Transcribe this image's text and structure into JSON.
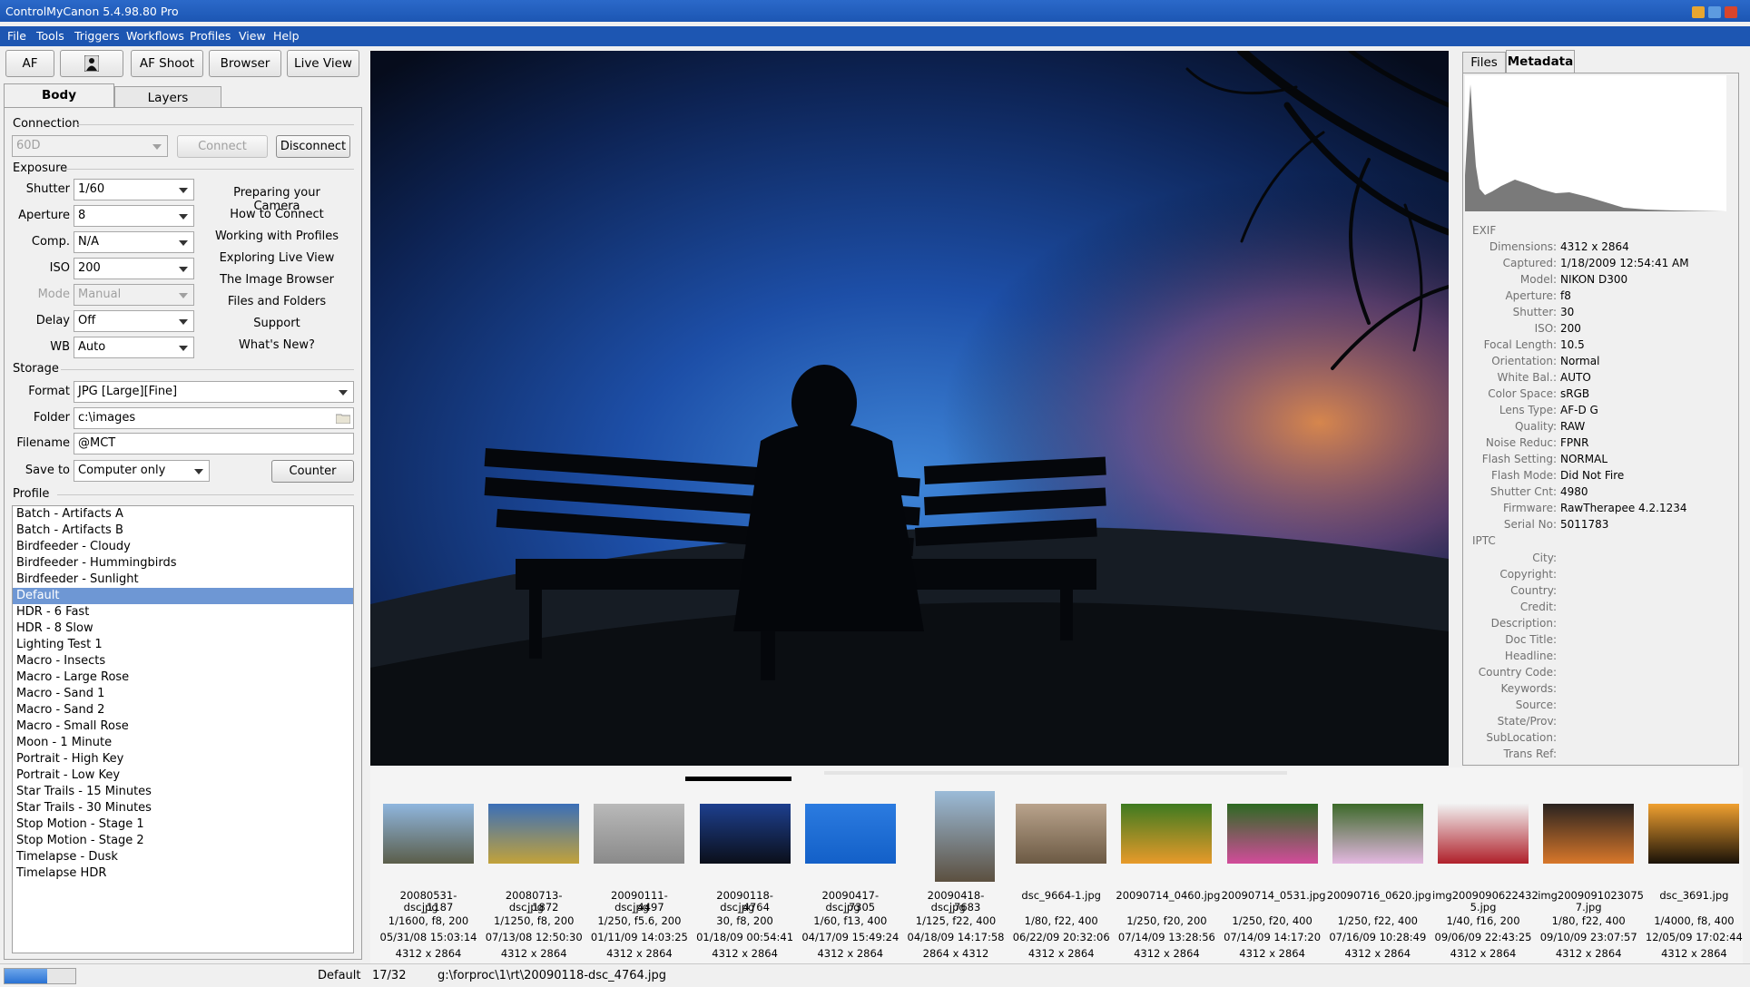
{
  "app": {
    "title": "ControlMyCanon 5.4.98.80 Pro",
    "menu": [
      "File",
      "Tools",
      "Triggers",
      "Workflows",
      "Profiles",
      "View",
      "Help"
    ]
  },
  "toolbar": {
    "af": "AF",
    "af_shoot": "AF Shoot",
    "browser": "Browser",
    "live_view": "Live View"
  },
  "left_tabs": [
    "Body",
    "Layers"
  ],
  "connection": {
    "section": "Connection",
    "camera_model": "60D",
    "connect": "Connect",
    "disconnect": "Disconnect"
  },
  "exposure": {
    "section": "Exposure",
    "fields": [
      {
        "label": "Shutter",
        "value": "1/60"
      },
      {
        "label": "Aperture",
        "value": "8"
      },
      {
        "label": "Comp.",
        "value": "N/A"
      },
      {
        "label": "ISO",
        "value": "200"
      },
      {
        "label": "Mode",
        "value": "Manual"
      },
      {
        "label": "Delay",
        "value": "Off"
      },
      {
        "label": "WB",
        "value": "Auto"
      }
    ]
  },
  "help_links": [
    "Preparing your Camera",
    "How to Connect",
    "Working with Profiles",
    "Exploring Live View",
    "The Image Browser",
    "Files and Folders",
    "Support",
    "What's New?"
  ],
  "storage": {
    "section": "Storage",
    "format_label": "Format",
    "format_value": "JPG [Large][Fine]",
    "folder_label": "Folder",
    "folder_value": "c:\\images",
    "filename_label": "Filename",
    "filename_value": "@MCT",
    "saveto_label": "Save to",
    "saveto_value": "Computer only",
    "counter": "Counter"
  },
  "profile": {
    "section": "Profile",
    "selected": "Default",
    "items": [
      "Batch - Artifacts A",
      "Batch - Artifacts B",
      "Birdfeeder - Cloudy",
      "Birdfeeder - Hummingbirds",
      "Birdfeeder - Sunlight",
      "Default",
      "HDR - 6 Fast",
      "HDR - 8 Slow",
      "Lighting Test 1",
      "Macro - Insects",
      "Macro - Large Rose",
      "Macro - Sand 1",
      "Macro - Sand 2",
      "Macro - Small Rose",
      "Moon - 1 Minute",
      "Portrait - High Key",
      "Portrait - Low Key",
      "Star Trails - 15 Minutes",
      "Star Trails - 30 Minutes",
      "Stop Motion - Stage 1",
      "Stop Motion - Stage 2",
      "Timelapse - Dusk",
      "Timelapse HDR"
    ]
  },
  "right_tabs": [
    "Files",
    "Metadata"
  ],
  "exif": {
    "title": "EXIF",
    "rows": [
      {
        "k": "Dimensions:",
        "v": "4312 x 2864"
      },
      {
        "k": "Captured:",
        "v": "1/18/2009 12:54:41 AM"
      },
      {
        "k": "Model:",
        "v": "NIKON D300"
      },
      {
        "k": "Aperture:",
        "v": "f8"
      },
      {
        "k": "Shutter:",
        "v": "30"
      },
      {
        "k": "ISO:",
        "v": "200"
      },
      {
        "k": "Focal Length:",
        "v": "10.5"
      },
      {
        "k": "Orientation:",
        "v": "Normal"
      },
      {
        "k": "White Bal.:",
        "v": "AUTO"
      },
      {
        "k": "Color Space:",
        "v": "sRGB"
      },
      {
        "k": "Lens Type:",
        "v": "AF-D G"
      },
      {
        "k": "Quality:",
        "v": "RAW"
      },
      {
        "k": "Noise Reduc:",
        "v": "FPNR"
      },
      {
        "k": "Flash Setting:",
        "v": "NORMAL"
      },
      {
        "k": "Flash Mode:",
        "v": "Did Not Fire"
      },
      {
        "k": "Shutter Cnt:",
        "v": "4980"
      },
      {
        "k": "Firmware:",
        "v": "RawTherapee 4.2.1234"
      },
      {
        "k": "Serial No:",
        "v": "5011783"
      }
    ]
  },
  "iptc": {
    "title": "IPTC",
    "rows": [
      "City:",
      "Copyright:",
      "Country:",
      "Credit:",
      "Description:",
      "Doc Title:",
      "Headline:",
      "Country Code:",
      "Keywords:",
      "Source:",
      "State/Prov:",
      "SubLocation:",
      "Trans Ref:"
    ]
  },
  "thumbnails": [
    {
      "name1": "20080531-dsc_1187",
      "name2": ".jpg",
      "meta": "1/1600, f8, 200",
      "date": "05/31/08 15:03:14",
      "dim": "4312 x 2864",
      "c1": "#8fb6de",
      "c2": "#5b5e4a"
    },
    {
      "name1": "20080713-dsc_1872",
      "name2": ".jpg",
      "meta": "1/1250, f8, 200",
      "date": "07/13/08 12:50:30",
      "dim": "4312 x 2864",
      "c1": "#3b6fb8",
      "c2": "#c2a23a"
    },
    {
      "name1": "20090111-dsc_4497",
      "name2": ".jpg",
      "meta": "1/250, f5.6, 200",
      "date": "01/11/09 14:03:25",
      "dim": "4312 x 2864",
      "c1": "#b9b9b9",
      "c2": "#8a8a8a"
    },
    {
      "name1": "20090118-dsc_4764",
      "name2": ".jpg",
      "meta": "30, f8, 200",
      "date": "01/18/09 00:54:41",
      "dim": "4312 x 2864",
      "c1": "#1d3f8e",
      "c2": "#0b0f1a"
    },
    {
      "name1": "20090417-dsc_7305",
      "name2": ".jpg",
      "meta": "1/60, f13, 400",
      "date": "04/17/09 15:49:24",
      "dim": "4312 x 2864",
      "c1": "#2b7be0",
      "c2": "#1360c8"
    },
    {
      "name1": "20090418-dsc_7683",
      "name2": ".jpg",
      "meta": "1/125, f22, 400",
      "date": "04/18/09 14:17:58",
      "dim": "2864 x 4312",
      "c1": "#9bbbd8",
      "c2": "#5c5040"
    },
    {
      "name1": "dsc_9664-1.jpg",
      "name2": "",
      "meta": "1/80, f22, 400",
      "date": "06/22/09 20:32:06",
      "dim": "4312 x 2864",
      "c1": "#b9a38c",
      "c2": "#6c5a44"
    },
    {
      "name1": "20090714_0460.jpg",
      "name2": "",
      "meta": "1/250, f20, 200",
      "date": "07/14/09 13:28:56",
      "dim": "4312 x 2864",
      "c1": "#3e7a20",
      "c2": "#e89a2a"
    },
    {
      "name1": "20090714_0531.jpg",
      "name2": "",
      "meta": "1/250, f20, 400",
      "date": "07/14/09 14:17:20",
      "dim": "4312 x 2864",
      "c1": "#2d6a22",
      "c2": "#d24c9a"
    },
    {
      "name1": "20090716_0620.jpg",
      "name2": "",
      "meta": "1/250, f22, 400",
      "date": "07/16/09 10:28:49",
      "dim": "4312 x 2864",
      "c1": "#3d6a2a",
      "c2": "#e3b7e0"
    },
    {
      "name1": "img2009090622432",
      "name2": "5.jpg",
      "meta": "1/40, f16, 200",
      "date": "09/06/09 22:43:25",
      "dim": "4312 x 2864",
      "c1": "#f2f2f2",
      "c2": "#b0202a"
    },
    {
      "name1": "img2009091023075",
      "name2": "7.jpg",
      "meta": "1/80, f22, 400",
      "date": "09/10/09 23:07:57",
      "dim": "4312 x 2864",
      "c1": "#2a2320",
      "c2": "#d8772a"
    },
    {
      "name1": "dsc_3691.jpg",
      "name2": "",
      "meta": "1/4000, f8, 400",
      "date": "12/05/09 17:02:44",
      "dim": "4312 x 2864",
      "c1": "#f0a030",
      "c2": "#1a1208"
    }
  ],
  "status": {
    "profile": "Default",
    "index": "17/32",
    "path": "g:\\forproc\\1\\rt\\20090118-dsc_4764.jpg",
    "progress": 0.6
  },
  "colors": {
    "titlebar": "#1d56b2",
    "selection": "#6e97d4"
  }
}
